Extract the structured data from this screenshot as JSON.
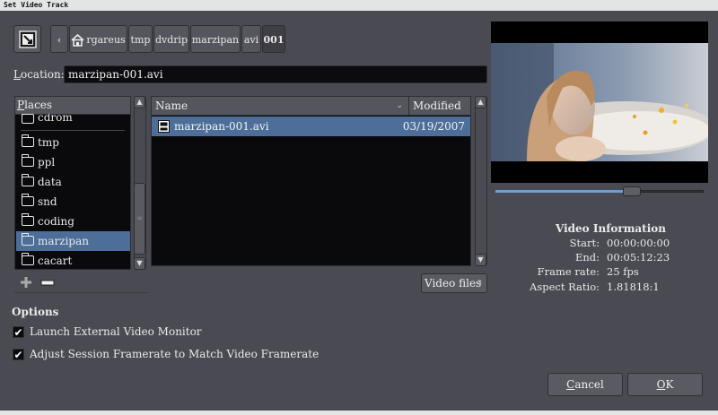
{
  "window": {
    "title": "Set Video Track"
  },
  "breadcrumbs": [
    {
      "label": "rgareus",
      "home": true
    },
    {
      "label": "tmp"
    },
    {
      "label": "dvdrip"
    },
    {
      "label": "marzipan"
    },
    {
      "label": "avi"
    },
    {
      "label": "001",
      "active": true
    }
  ],
  "location": {
    "label": "Location:",
    "accel": "L",
    "rest": "ocation:",
    "value": "marzipan-001.avi"
  },
  "places": {
    "header": "Places",
    "header_accel": "P",
    "header_rest": "laces",
    "items": [
      "cdrom",
      "tmp",
      "ppl",
      "data",
      "snd",
      "coding",
      "marzipan",
      "cacart"
    ],
    "selected": "marzipan"
  },
  "files": {
    "col_name": "Name",
    "col_modified": "Modified",
    "rows": [
      {
        "name": "marzipan-001.avi",
        "modified": "03/19/2007",
        "selected": true
      }
    ]
  },
  "filter": {
    "value": "Video files"
  },
  "options": {
    "title": "Options",
    "launch_monitor": {
      "label": "Launch External Video Monitor",
      "checked": true
    },
    "adjust_framerate": {
      "label": "Adjust Session Framerate to Match Video Framerate",
      "checked": true
    }
  },
  "preview": {
    "seek_position": 0.67
  },
  "video_info": {
    "title": "Video Information",
    "rows": [
      {
        "key": "Start:",
        "value": "00:00:00:00"
      },
      {
        "key": "End:",
        "value": "00:05:12:23"
      },
      {
        "key": "Frame rate:",
        "value": "25 fps"
      },
      {
        "key": "Aspect Ratio:",
        "value": "1.81818:1"
      }
    ]
  },
  "buttons": {
    "cancel": {
      "accel": "C",
      "rest": "ancel"
    },
    "ok": {
      "accel": "O",
      "rest": "K"
    }
  },
  "colors": {
    "selection": "#4c6e99",
    "background": "#4a4a52",
    "panel": "#0a0a0c"
  },
  "icons": [
    "toggle-typing-icon",
    "back-icon",
    "home-icon",
    "folder-icon",
    "file-icon",
    "add-icon",
    "remove-icon",
    "checkmark-icon"
  ]
}
